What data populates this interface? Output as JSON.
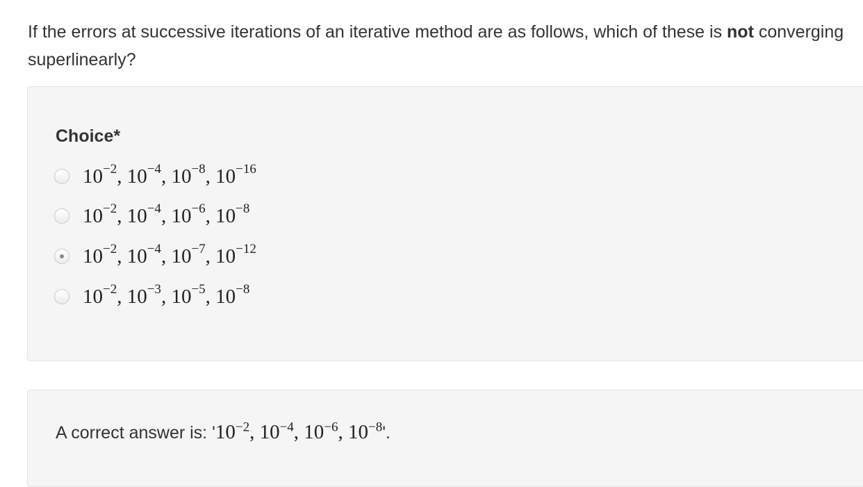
{
  "question": {
    "text_before": "If the errors at successive iterations of an iterative method are as follows, which of these is ",
    "emphasis": "not",
    "text_after": " converging superlinearly?"
  },
  "choices": {
    "label": "Choice*",
    "selected_index": 2,
    "options": [
      {
        "terms": [
          {
            "base": "10",
            "exp": "−2"
          },
          {
            "base": "10",
            "exp": "−4"
          },
          {
            "base": "10",
            "exp": "−8"
          },
          {
            "base": "10",
            "exp": "−16"
          }
        ]
      },
      {
        "terms": [
          {
            "base": "10",
            "exp": "−2"
          },
          {
            "base": "10",
            "exp": "−4"
          },
          {
            "base": "10",
            "exp": "−6"
          },
          {
            "base": "10",
            "exp": "−8"
          }
        ]
      },
      {
        "terms": [
          {
            "base": "10",
            "exp": "−2"
          },
          {
            "base": "10",
            "exp": "−4"
          },
          {
            "base": "10",
            "exp": "−7"
          },
          {
            "base": "10",
            "exp": "−12"
          }
        ]
      },
      {
        "terms": [
          {
            "base": "10",
            "exp": "−2"
          },
          {
            "base": "10",
            "exp": "−3"
          },
          {
            "base": "10",
            "exp": "−5"
          },
          {
            "base": "10",
            "exp": "−8"
          }
        ]
      }
    ]
  },
  "answer": {
    "prefix": "A correct answer is: '",
    "terms": [
      {
        "base": "10",
        "exp": "−2"
      },
      {
        "base": "10",
        "exp": "−4"
      },
      {
        "base": "10",
        "exp": "−6"
      },
      {
        "base": "10",
        "exp": "−8"
      }
    ],
    "suffix": "'."
  },
  "colors": {
    "panel_background": "#f5f5f5",
    "panel_border": "#e3e3e3",
    "text": "#333333"
  }
}
